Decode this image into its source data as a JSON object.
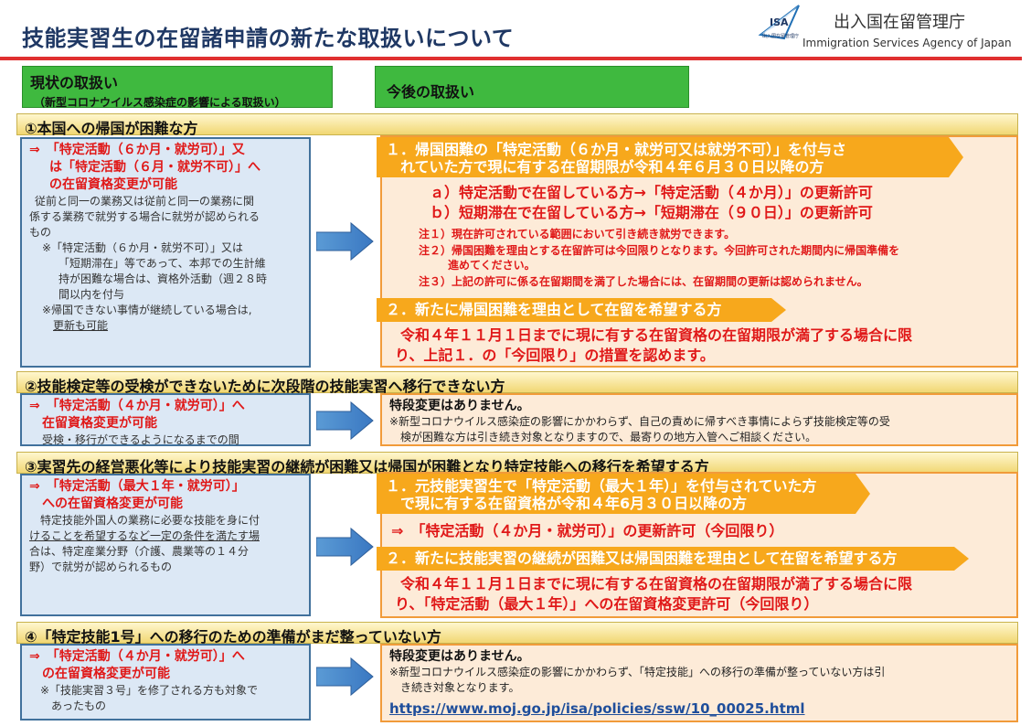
{
  "header": {
    "title": "技能実習生の在留諸申請の新たな取扱いについて",
    "logo_text": "ISA",
    "logo_sub": "出入国在留管理庁",
    "agency_ja": "出入国在留管理庁",
    "agency_en": "Immigration Services Agency of Japan"
  },
  "columns": {
    "current_title": "現状の取扱い",
    "current_sub": "（新型コロナウイルス感染症の影響による取扱い）",
    "future_title": "今後の取扱い"
  },
  "sections": [
    {
      "heading": "①本国への帰国が困難な方",
      "left": {
        "red_l1": "⇒　「特定活動（６か月・就労可）」又",
        "red_l2": "は「特定活動（６月・就労不可）」へ",
        "red_l3": "の在留資格変更が可能",
        "b1": "従前と同一の業務又は従前と同一の業務に関",
        "b2": "係する業務で就労する場合に就労が認められる",
        "b3": "もの",
        "n1": "※「特定活動（６か月・就労不可）」又は",
        "n2": "「短期滞在」等であって、本邦での生計維",
        "n3": "持が困難な場合は、資格外活動（週２８時",
        "n4": "間以内を付与",
        "n5": "※帰国できない事情が継続している場合は,",
        "n6": "更新も可能"
      },
      "right": {
        "band1_l1": "１．帰国困難の「特定活動（６か月・就労可又は就労不可）」を付与さ",
        "band1_l2": "　れていた方で現に有する在留期限が令和４年６月３０日以降の方",
        "a": "ａ）特定活動で在留している方→「特定活動（４か月）」の更新許可",
        "b": "ｂ）短期滞在で在留している方→「短期滞在（９０日）」の更新許可",
        "note1": "注１）現在許可されている範囲において引き続き就労できます。",
        "note2a": "注２）帰国困難を理由とする在留許可は今回限りとなります。今回許可された期間内に帰国準備を",
        "note2b": "進めてください。",
        "note3": "注３）上記の許可に係る在留期間を満了した場合には、在留期間の更新は認められません。",
        "band2": "２．新たに帰国困難を理由として在留を希望する方",
        "p1": "令和４年１１月１日までに現に有する在留資格の在留期限が満了する場合に限",
        "p2": "り、上記１．の「今回限り」の措置を認めます。"
      }
    },
    {
      "heading": "②技能検定等の受検ができないために次段階の技能実習へ移行できない方",
      "left": {
        "red_l1": "⇒　「特定活動（４か月・就労可）」へ",
        "red_l2": "在留資格変更が可能",
        "b1": "受検・移行ができるようになるまでの間"
      },
      "right": {
        "h": "特段変更はありません。",
        "t1": "※新型コロナウイルス感染症の影響にかかわらず、自己の責めに帰すべき事情によらず技能検定等の受",
        "t2": "検が困難な方は引き続き対象となりますので、最寄りの地方入管へご相談ください。"
      }
    },
    {
      "heading": "③実習先の経営悪化等により技能実習の継続が困難又は帰国が困難となり特定技能への移行を希望する方",
      "left": {
        "red_l1": "⇒　「特定活動（最大１年・就労可）」",
        "red_l2": "への在留資格変更が可能",
        "b1": "特定技能外国人の業務に必要な技能を身に付",
        "b2": "けることを希望するなど一定の条件を満たす場",
        "b3": "合は、特定産業分野（介護、農業等の１４分",
        "b4": "野）で就労が認められるもの"
      },
      "right": {
        "band1_l1": "１．元技能実習生で「特定活動（最大１年）」を付与されていた方",
        "band1_l2": "　で現に有する在留資格が令和４年6月３０日以降の方",
        "arrow_line": "⇒　「特定活動（４か月・就労可）」の更新許可（今回限り）",
        "band2": "２．新たに技能実習の継続が困難又は帰国困難を理由として在留を希望する方",
        "p1": "令和４年１１月１日までに現に有する在留資格の在留期限が満了する場合に限",
        "p2": "り、「特定活動（最大１年）」への在留資格変更許可（今回限り）"
      }
    },
    {
      "heading": "④「特定技能1号」への移行のための準備がまだ整っていない方",
      "left": {
        "red_l1": "⇒　「特定活動（４か月・就労可）」へ",
        "red_l2": "の在留資格変更が可能",
        "n1": "※「技能実習３号」を修了される方も対象で",
        "n2": "あったもの"
      },
      "right": {
        "h": "特段変更はありません。",
        "t1": "※新型コロナウイルス感染症の影響にかかわらず、「特定技能」への移行の準備が整っていない方は引",
        "t2": "き続き対象となります。",
        "link": "https://www.moj.go.jp/isa/policies/ssw/10_00025.html"
      }
    }
  ]
}
